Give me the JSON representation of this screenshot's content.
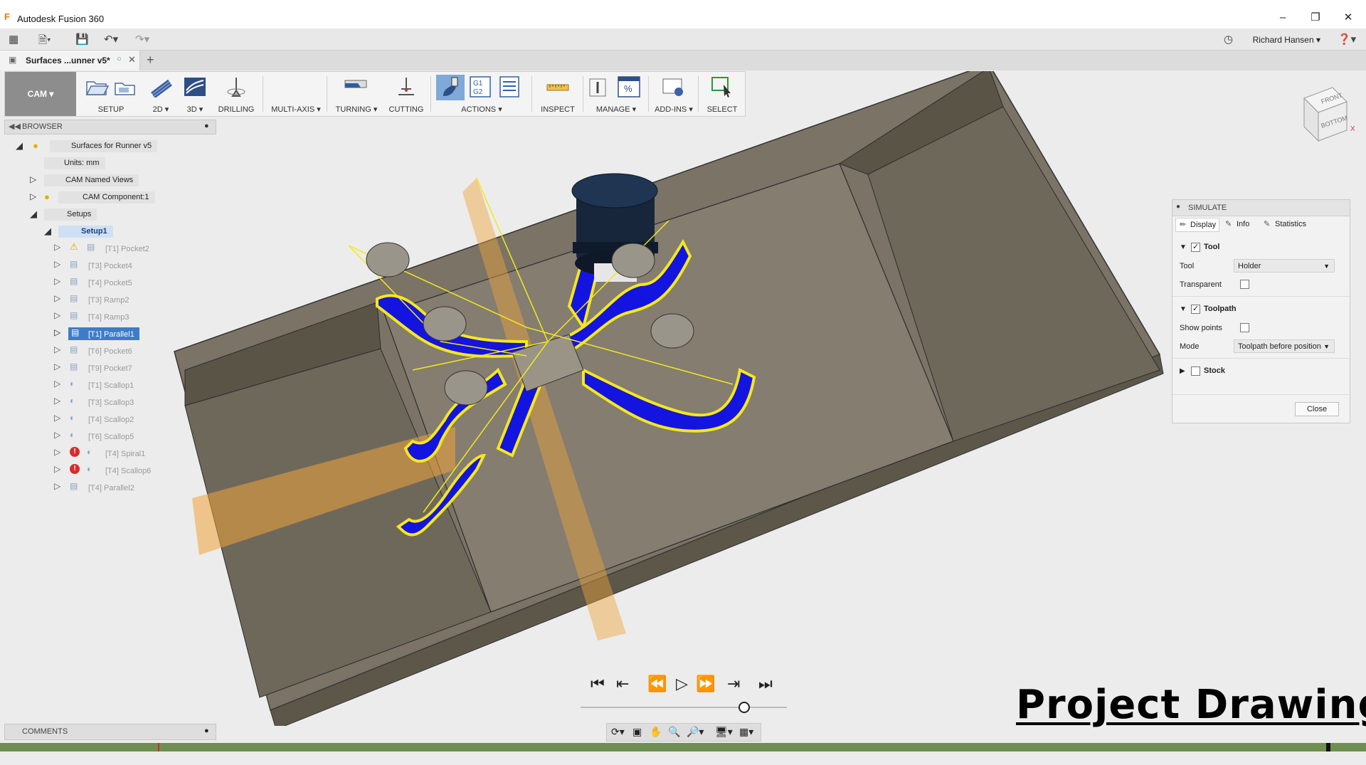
{
  "window": {
    "title": "Autodesk Fusion 360",
    "user": "Richard Hansen"
  },
  "tab": {
    "label": "Surfaces ...unner v5*"
  },
  "ribbon": {
    "workspace": "CAM",
    "groups": [
      "SETUP",
      "2D",
      "3D",
      "DRILLING",
      "MULTI-AXIS",
      "TURNING",
      "CUTTING",
      "ACTIONS",
      "INSPECT",
      "MANAGE",
      "ADD-INS",
      "SELECT"
    ]
  },
  "browser": {
    "header": "BROWSER",
    "root": "Surfaces for Runner v5",
    "units": "Units: mm",
    "named_views": "CAM Named Views",
    "component": "CAM Component:1",
    "setups": "Setups",
    "setup1": "Setup1",
    "operations": [
      "[T1] Pocket2",
      "[T3] Pocket4",
      "[T4] Pocket5",
      "[T3] Ramp2",
      "[T4] Ramp3",
      "[T1] Parallel1",
      "[T6] Pocket6",
      "[T9] Pocket7",
      "[T1] Scallop1",
      "[T3] Scallop3",
      "[T4] Scallop2",
      "[T6] Scallop5",
      "[T4] Spiral1",
      "[T4] Scallop6",
      "[T4] Parallel2"
    ]
  },
  "comments": {
    "header": "COMMENTS"
  },
  "viewcube": {
    "front": "FRONT",
    "bottom": "BOTTOM",
    "axis": "X"
  },
  "simulate": {
    "title": "SIMULATE",
    "tabs": [
      "Display",
      "Info",
      "Statistics"
    ],
    "tool_section": "Tool",
    "tool_label": "Tool",
    "tool_value": "Holder",
    "transparent_label": "Transparent",
    "toolpath_section": "Toolpath",
    "show_points_label": "Show points",
    "mode_label": "Mode",
    "mode_value": "Toolpath before position",
    "stock_section": "Stock",
    "close_label": "Close",
    "tool_checked": true,
    "toolpath_checked": true,
    "stock_checked": false
  },
  "overlay": {
    "text": "Project Drawing"
  },
  "colors": {
    "accent": "#3d7cc9",
    "toolpath_blue": "#1414e0",
    "toolpath_yellow": "#f4e81a",
    "timeline": "#6f8f52"
  }
}
